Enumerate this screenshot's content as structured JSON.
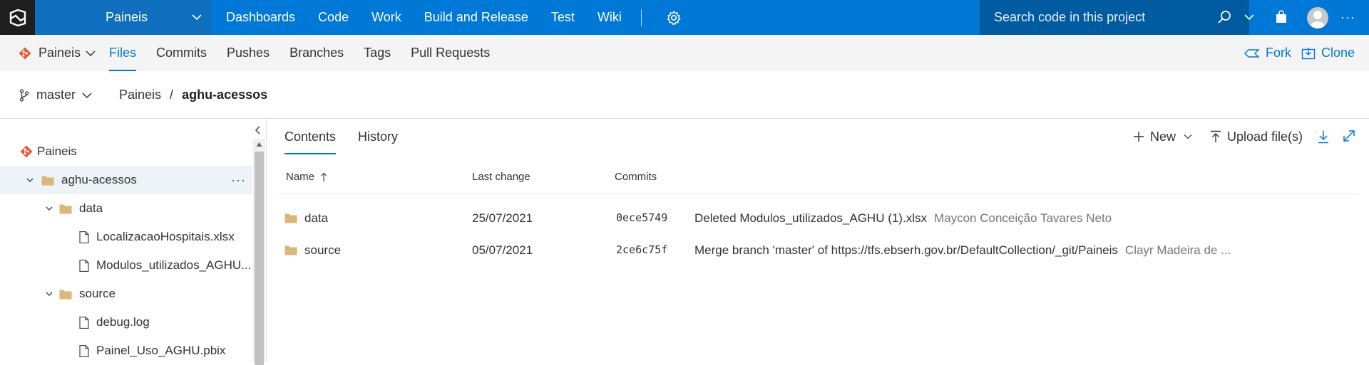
{
  "topbar": {
    "project": "Paineis",
    "nav": [
      "Dashboards",
      "Code",
      "Work",
      "Build and Release",
      "Test",
      "Wiki"
    ],
    "active_nav": "Code",
    "search_placeholder": "Search code in this project",
    "more": "···"
  },
  "subnav": {
    "repo": "Paineis",
    "tabs": [
      "Files",
      "Commits",
      "Pushes",
      "Branches",
      "Tags",
      "Pull Requests"
    ],
    "active_tab": "Files",
    "fork": "Fork",
    "clone": "Clone"
  },
  "branchbar": {
    "branch": "master",
    "breadcrumb": [
      "Paineis",
      "aghu-acessos"
    ],
    "breadcrumb_sep": "/"
  },
  "tree": {
    "root": "Paineis",
    "selected": "aghu-acessos",
    "more": "···",
    "nodes": [
      {
        "label": "aghu-acessos",
        "type": "folder",
        "level": 1,
        "expanded": true
      },
      {
        "label": "data",
        "type": "folder",
        "level": 2,
        "expanded": true
      },
      {
        "label": "LocalizacaoHospitais.xlsx",
        "type": "file",
        "level": 3
      },
      {
        "label": "Modulos_utilizados_AGHU...",
        "type": "file",
        "level": 3
      },
      {
        "label": "source",
        "type": "folder",
        "level": 2,
        "expanded": true
      },
      {
        "label": "debug.log",
        "type": "file",
        "level": 3
      },
      {
        "label": "Painel_Uso_AGHU.pbix",
        "type": "file",
        "level": 3
      }
    ]
  },
  "content": {
    "tabs": [
      "Contents",
      "History"
    ],
    "active_tab": "Contents",
    "actions": {
      "new": "New",
      "upload": "Upload file(s)"
    },
    "columns": [
      "Name",
      "Last change",
      "Commits"
    ],
    "rows": [
      {
        "name": "data",
        "last_change": "25/07/2021",
        "commit": "0ece5749",
        "message": "Deleted Modulos_utilizados_AGHU (1).xlsx",
        "author": "Maycon Conceição Tavares Neto"
      },
      {
        "name": "source",
        "last_change": "05/07/2021",
        "commit": "2ce6c75f",
        "message": "Merge branch 'master' of https://tfs.ebserh.gov.br/DefaultCollection/_git/Paineis",
        "author": "Clayr Madeira de ..."
      }
    ]
  },
  "colors": {
    "topbar": "#0078d7",
    "topbar_project": "#106ebe",
    "search_bg": "#005ba1",
    "accent": "#0078d7",
    "folder": "#dcb67a",
    "git_icon": "#e05b36"
  }
}
